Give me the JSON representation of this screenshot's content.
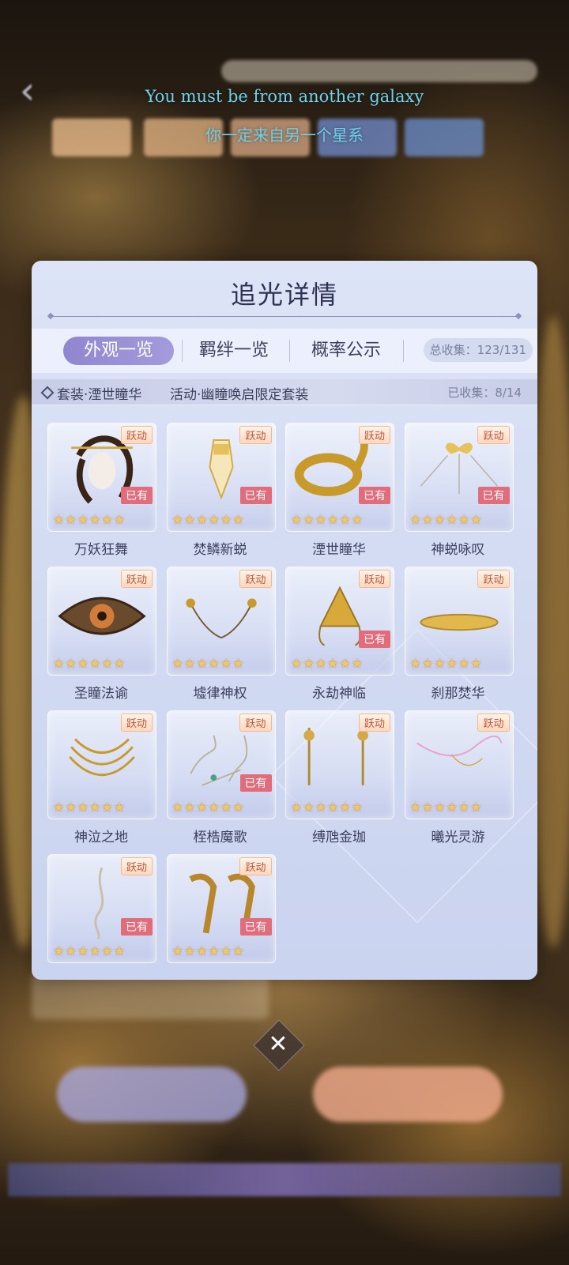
{
  "subtitles": {
    "english": "You must be from another galaxy",
    "chinese": "你一定来自另一个星系"
  },
  "panel": {
    "title": "追光详情",
    "tabs": [
      {
        "label": "外观一览",
        "active": true
      },
      {
        "label": "羁绊一览",
        "active": false
      },
      {
        "label": "概率公示",
        "active": false
      }
    ],
    "total_collected": "总收集：123/131",
    "suit": {
      "name": "套装·湮世瞳华",
      "source": "活动·幽瞳唤启限定套装",
      "collected": "已收集：8/14"
    },
    "items": [
      {
        "name": "万妖狂舞",
        "tag": "跃动",
        "owned": true,
        "stars": "★★★★★★",
        "icon": "hair-icon"
      },
      {
        "name": "焚鳞新蜕",
        "tag": "跃动",
        "owned": true,
        "stars": "★★★★★★",
        "icon": "dress-icon"
      },
      {
        "name": "湮世瞳华",
        "tag": "跃动",
        "owned": true,
        "stars": "★★★★★★",
        "icon": "serpent-icon"
      },
      {
        "name": "神蜕咏叹",
        "tag": "跃动",
        "owned": true,
        "stars": "★★★★★★",
        "icon": "bow-icon"
      },
      {
        "name": "圣瞳法谕",
        "tag": "跃动",
        "owned": false,
        "stars": "★★★★★★",
        "icon": "eye-icon"
      },
      {
        "name": "墟律神权",
        "tag": "跃动",
        "owned": false,
        "stars": "★★★★★★",
        "icon": "chain-icon"
      },
      {
        "name": "永劫神临",
        "tag": "跃动",
        "owned": true,
        "stars": "★★★★★★",
        "icon": "crown-icon"
      },
      {
        "name": "刹那焚华",
        "tag": "跃动",
        "owned": false,
        "stars": "★★★★★★",
        "icon": "clasp-icon"
      },
      {
        "name": "神泣之地",
        "tag": "跃动",
        "owned": false,
        "stars": "★★★★★★",
        "icon": "necklace-icon"
      },
      {
        "name": "桎梏魔歌",
        "tag": "跃动",
        "owned": true,
        "stars": "★★★★★★",
        "icon": "shackle-icon"
      },
      {
        "name": "缚虺金珈",
        "tag": "跃动",
        "owned": false,
        "stars": "★★★★★★",
        "icon": "earring-icon"
      },
      {
        "name": "曦光灵游",
        "tag": "跃动",
        "owned": false,
        "stars": "★★★★★★",
        "icon": "ribbon-icon"
      },
      {
        "name": "",
        "tag": "跃动",
        "owned": true,
        "stars": "★★★★★★",
        "icon": "pendant-icon"
      },
      {
        "name": "",
        "tag": "跃动",
        "owned": true,
        "stars": "★★★★★★",
        "icon": "heels-icon"
      }
    ],
    "owned_label": "已有"
  },
  "close": {
    "glyph": "✕"
  },
  "colors": {
    "accent": "#9b92d6",
    "owned": "#e06c7c",
    "star": "#f2c66a",
    "subtitle": "#6fd0ea"
  }
}
